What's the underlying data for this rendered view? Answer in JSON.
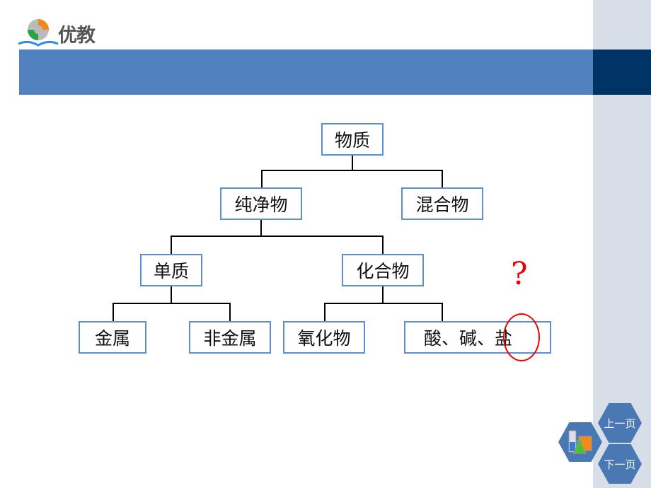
{
  "logo": {
    "text": "优教"
  },
  "tree": {
    "root": "物质",
    "pure": "纯净物",
    "mixture": "混合物",
    "element": "单质",
    "compound": "化合物",
    "metal": "金属",
    "nonmetal": "非金属",
    "oxide": "氧化物",
    "acid_base_salt_prefix": "酸、碱、",
    "salt": "盐"
  },
  "annotation": {
    "question_mark": "?",
    "color": "#e00000"
  },
  "nav": {
    "prev": "上一页",
    "next": "下一页",
    "icon": "lab-glassware-icon"
  },
  "colors": {
    "banner": "#5181bf",
    "navy": "#003366",
    "sidebar": "#d7dee8",
    "box_border": "#5b8fd0"
  }
}
